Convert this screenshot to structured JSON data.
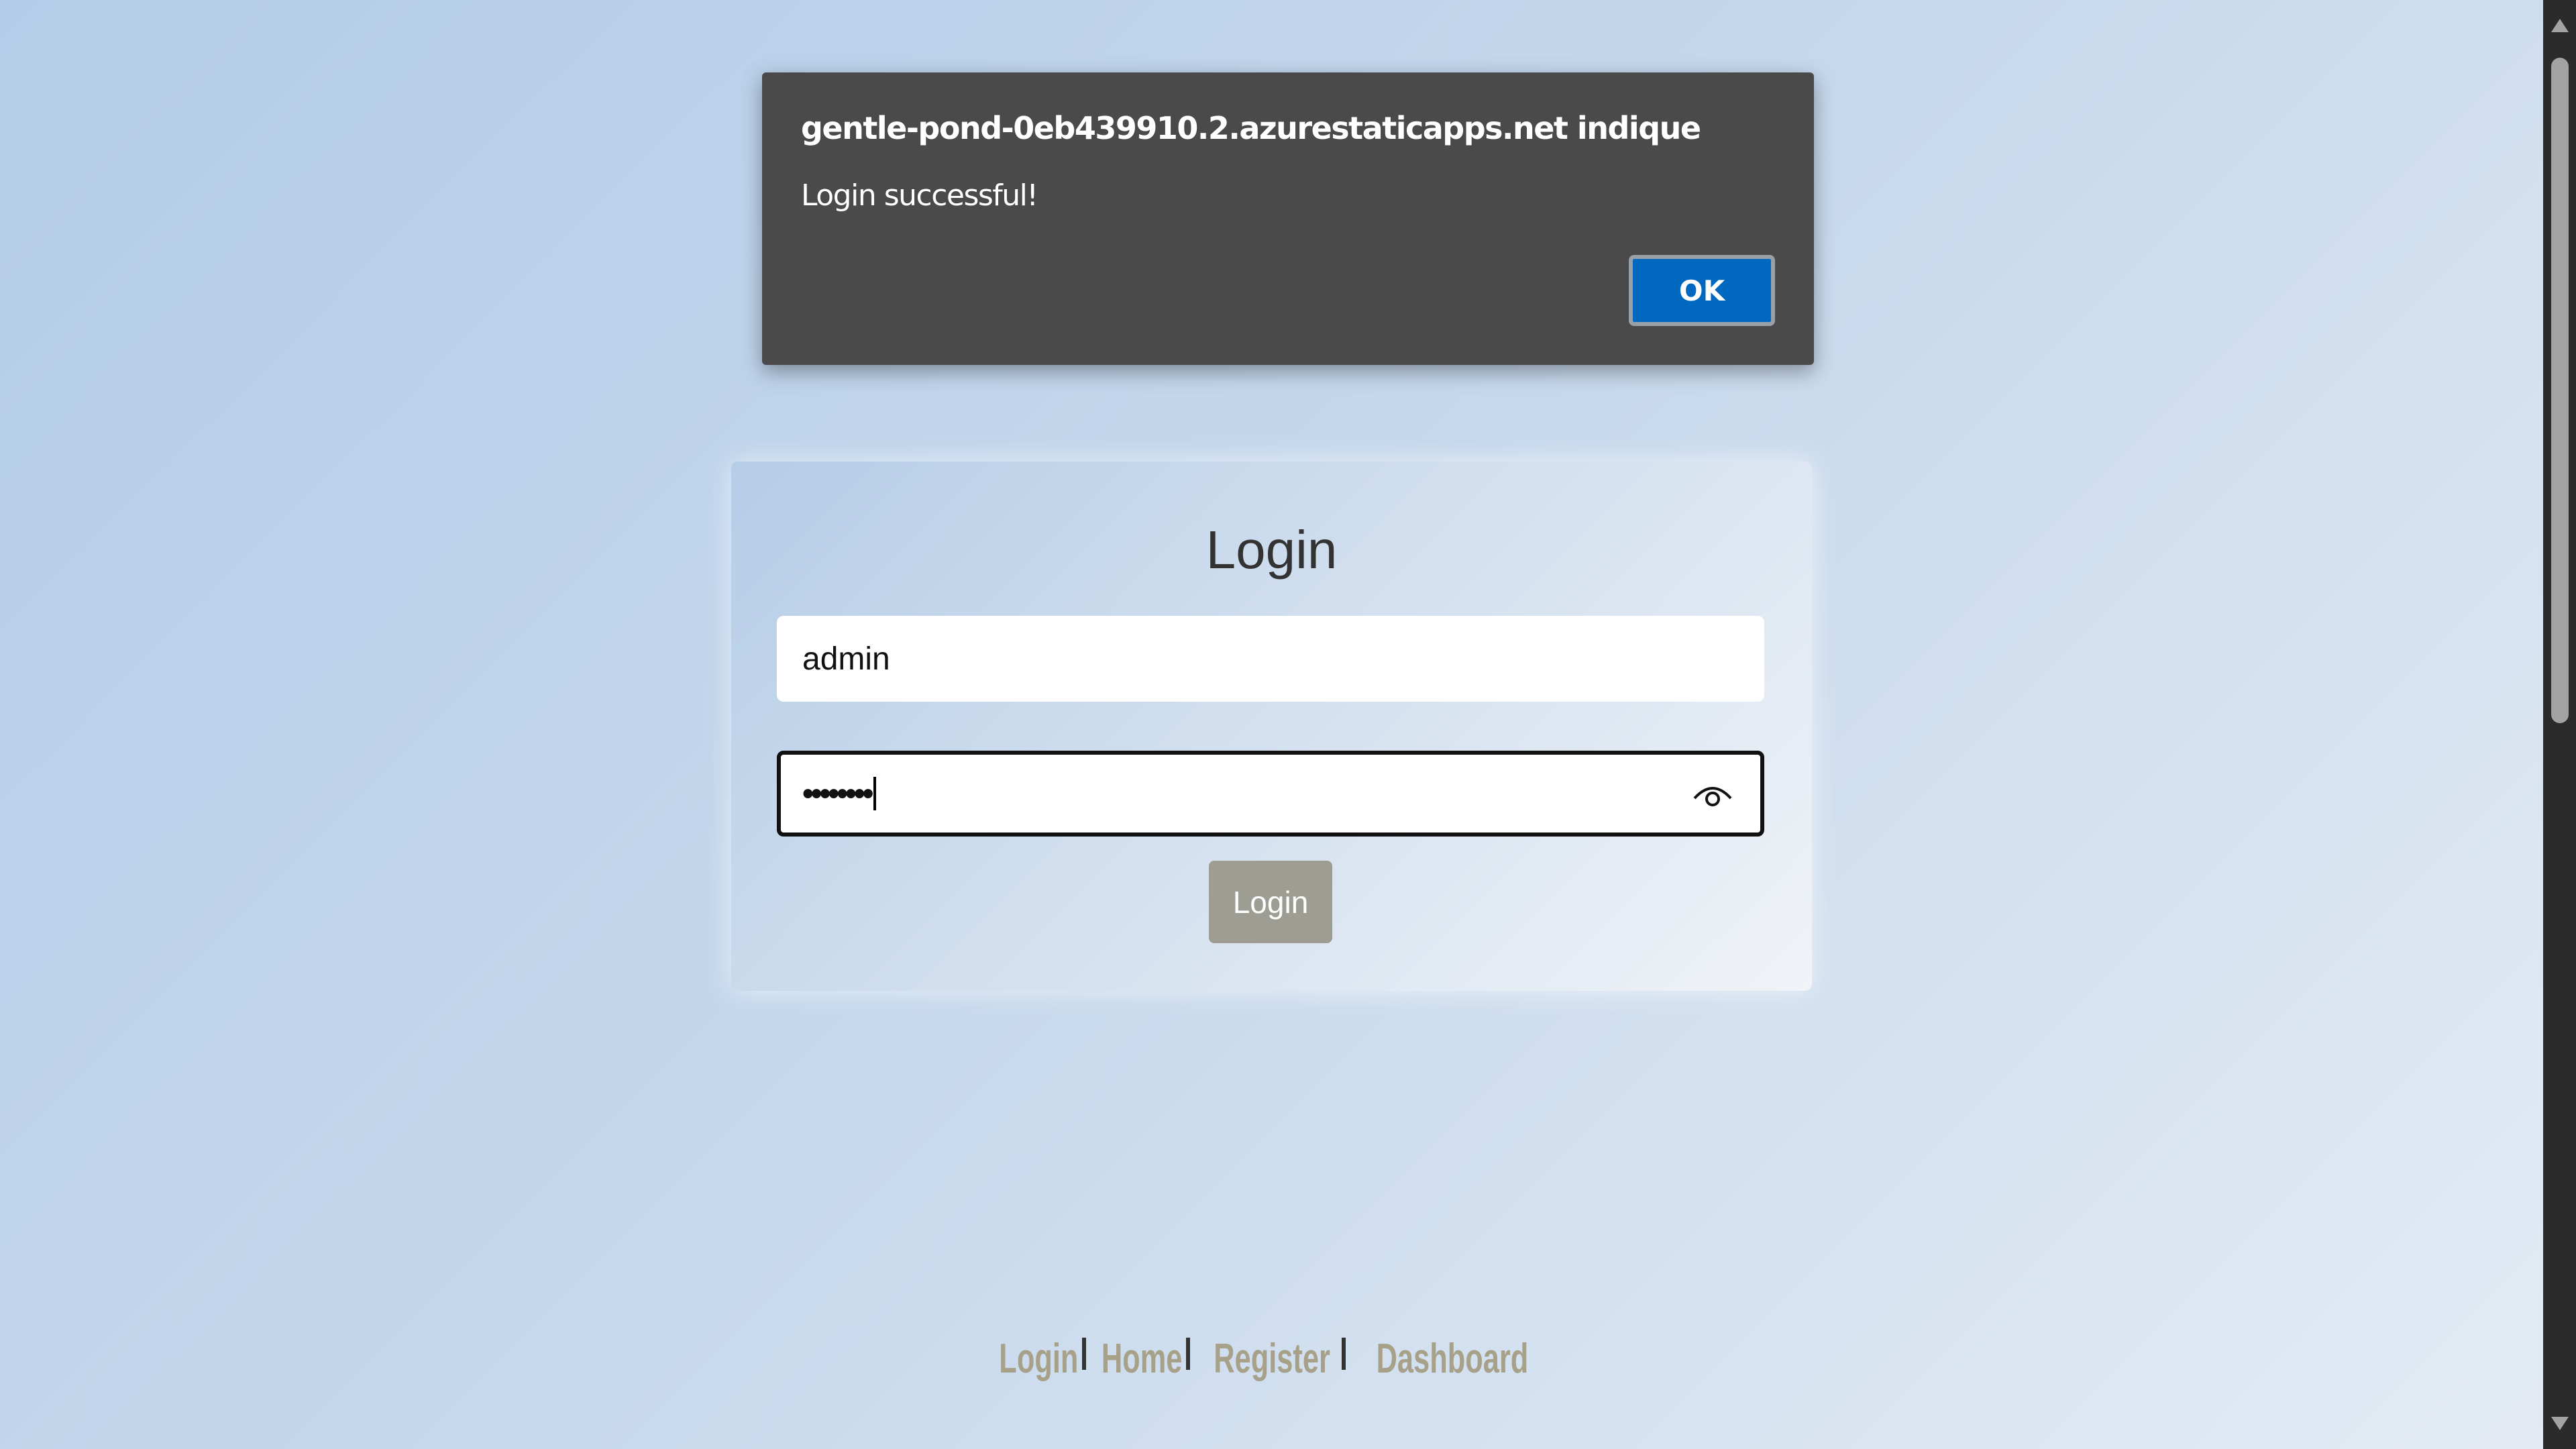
{
  "dialog": {
    "title": "gentle-pond-0eb439910.2.azurestaticapps.net indique",
    "message": "Login successful!",
    "ok_label": "OK",
    "ok_color": "#0068bf"
  },
  "login": {
    "title": "Login",
    "username_value": "admin",
    "password_value": "••••••••",
    "toggle_icon": "eye-icon",
    "submit_label": "Login"
  },
  "footer": {
    "links": [
      "Login",
      "Home",
      "Register",
      "Dashboard"
    ],
    "link_color": "#a8a18a"
  }
}
